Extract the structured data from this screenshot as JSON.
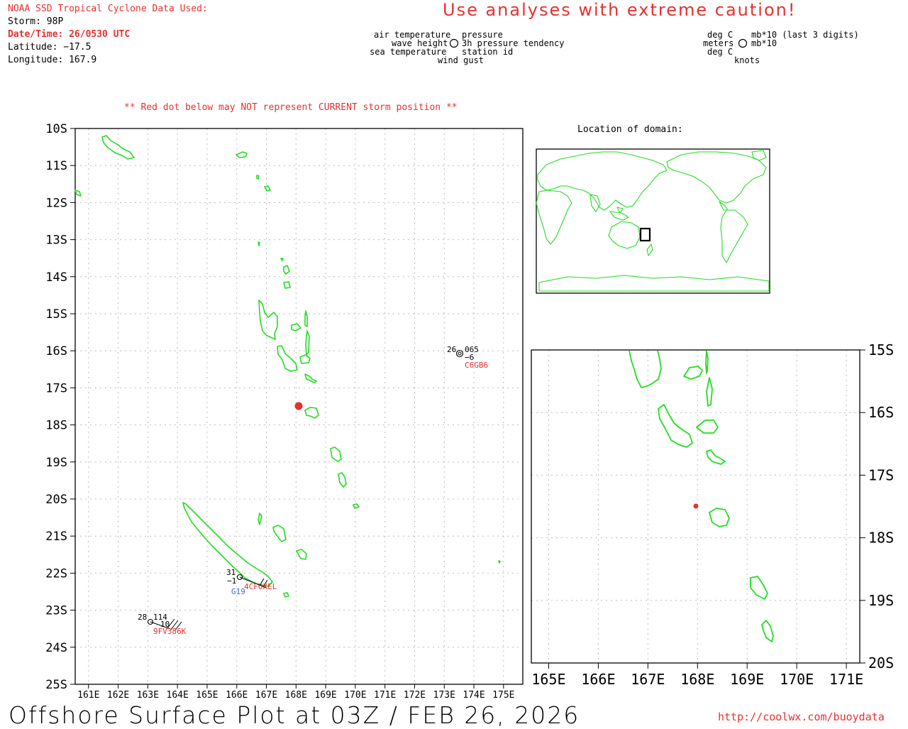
{
  "header": {
    "source": "NOAA SSD Tropical Cyclone Data Used:",
    "storm": "Storm: 98P",
    "datetime": "Date/Time: 26/0530 UTC",
    "latitude": "Latitude: −17.5",
    "longitude": "Longitude: 167.9",
    "caution": "Use analyses with extreme caution!"
  },
  "legend": {
    "air_temperature": "air temperature",
    "wave_height": "wave height",
    "sea_temperature": "sea temperature",
    "pressure": "pressure",
    "pressure_tendency": "3h pressure tendency",
    "station_id": "station id",
    "wind_gust": "wind gust"
  },
  "units": {
    "deg_c_1": "deg C",
    "meters": "meters",
    "deg_c_2": "deg C",
    "mb_last3": "mb*10 (last 3 digits)",
    "mb": "mb*10",
    "knots": "knots"
  },
  "main_map": {
    "note": "** Red dot below may NOT represent CURRENT storm position **",
    "lat_labels": [
      "10S",
      "11S",
      "12S",
      "13S",
      "14S",
      "15S",
      "16S",
      "17S",
      "18S",
      "19S",
      "20S",
      "21S",
      "22S",
      "23S",
      "24S",
      "25S"
    ],
    "lon_labels": [
      "161E",
      "162E",
      "163E",
      "164E",
      "165E",
      "166E",
      "167E",
      "168E",
      "169E",
      "170E",
      "171E",
      "172E",
      "173E",
      "174E",
      "175E"
    ],
    "storm_position": {
      "lat": -17.5,
      "lon": 167.9
    },
    "stations": [
      {
        "id": "C6GB6",
        "air_temp": "26",
        "pressure": "065",
        "tendency": "−6",
        "color": "#e83030"
      },
      {
        "id": "4CFOXEL",
        "air_temp": "31",
        "sea_temp": "−1",
        "color": "#e83030"
      },
      {
        "id": "G19",
        "color": "#4a62d8"
      },
      {
        "id": "9FV386K",
        "air_temp": "28",
        "pressure": "114",
        "tendency": "10",
        "color": "#e83030"
      }
    ]
  },
  "inset_domain": {
    "title": "Location of domain:"
  },
  "zoom_map": {
    "lat_labels": [
      "15S",
      "16S",
      "17S",
      "18S",
      "19S",
      "20S"
    ],
    "lon_labels": [
      "165E",
      "166E",
      "167E",
      "168E",
      "169E",
      "170E",
      "171E"
    ]
  },
  "footer": {
    "title": "Offshore Surface Plot at 03Z / FEB 26, 2026",
    "url": "http://coolwx.com/buoydata"
  },
  "colors": {
    "coastline": "#22dd22",
    "storm_dot": "#e83030",
    "accent_text": "#e83030",
    "station_blue": "#4a62d8"
  }
}
